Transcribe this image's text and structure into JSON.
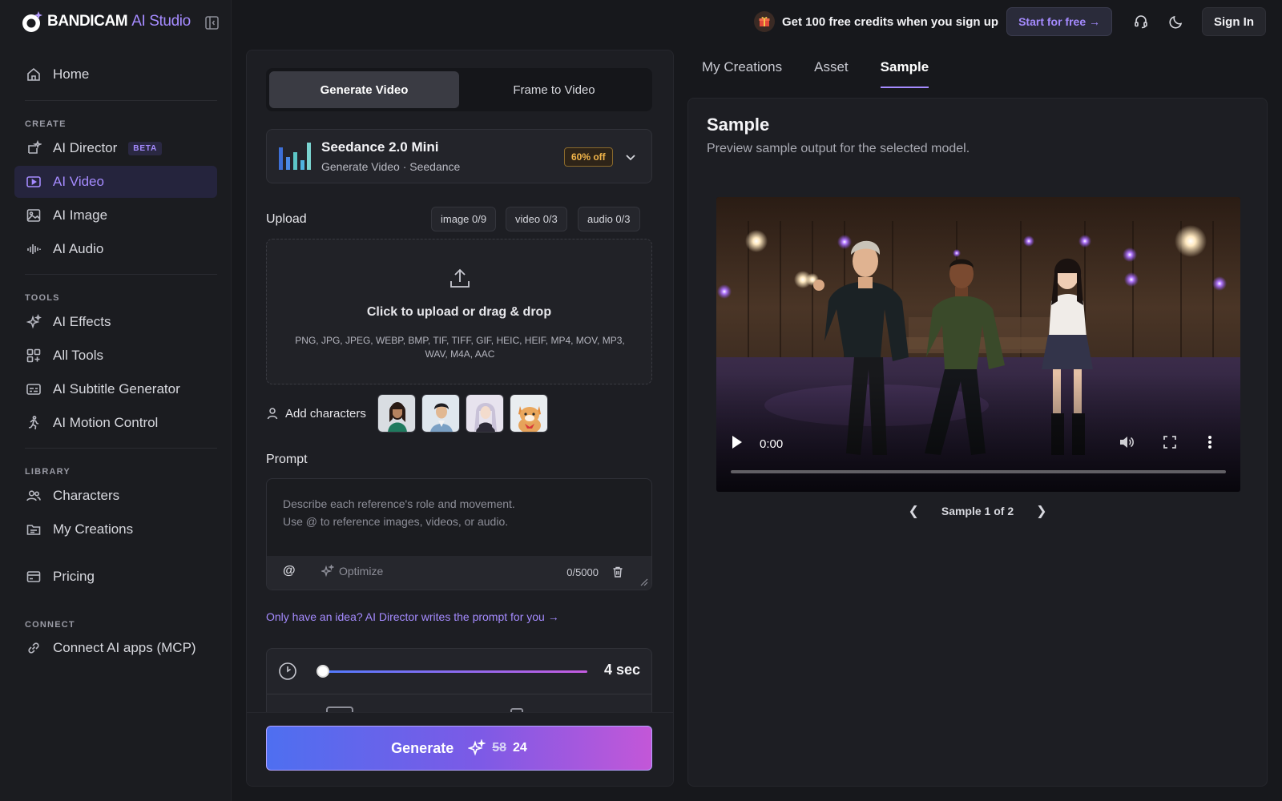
{
  "brand": {
    "name": "BANDICAM",
    "studio": "AI Studio"
  },
  "sidebar": {
    "home": "Home",
    "create_label": "CREATE",
    "create_items": [
      {
        "label": "AI Director",
        "badge": "BETA"
      },
      {
        "label": "AI Video"
      },
      {
        "label": "AI Image"
      },
      {
        "label": "AI Audio"
      }
    ],
    "tools_label": "TOOLS",
    "tools_items": [
      {
        "label": "AI Effects"
      },
      {
        "label": "All Tools"
      },
      {
        "label": "AI Subtitle Generator"
      },
      {
        "label": "AI Motion Control"
      }
    ],
    "library_label": "LIBRARY",
    "library_items": [
      {
        "label": "Characters"
      },
      {
        "label": "My Creations"
      }
    ],
    "pricing": "Pricing",
    "connect_label": "CONNECT",
    "connect_items": [
      {
        "label": "Connect AI apps (MCP)"
      }
    ]
  },
  "topbar": {
    "promo": "Get 100 free credits when you sign up",
    "start_button": "Start for free →",
    "signin": "Sign In"
  },
  "generator": {
    "tabs": [
      "Generate Video",
      "Frame to Video"
    ],
    "active_tab": "Generate Video",
    "model": {
      "name": "Seedance 2.0 Mini",
      "subtitle": "Generate Video · Seedance",
      "discount": "60% off"
    },
    "upload": {
      "label": "Upload",
      "chips": [
        "image 0/9",
        "video 0/3",
        "audio 0/3"
      ],
      "title": "Click to upload or drag & drop",
      "formats": "PNG, JPG, JPEG, WEBP, BMP, TIF, TIFF, GIF, HEIC, HEIF, MP4, MOV, MP3, WAV, M4A, AAC"
    },
    "characters": {
      "label": "Add characters"
    },
    "prompt": {
      "label": "Prompt",
      "placeholder": "Describe each reference's role and movement.\nUse @ to reference images, videos, or audio.",
      "at": "@",
      "optimize": "Optimize",
      "count": "0/5000"
    },
    "idea_link": "Only have an idea? AI Director writes the prompt for you →",
    "duration": {
      "value": "4 sec",
      "fraction": 0.0
    },
    "generate": {
      "label": "Generate",
      "old_cost": "58",
      "new_cost": "24"
    }
  },
  "right": {
    "tabs": [
      "My Creations",
      "Asset",
      "Sample"
    ],
    "active_tab": "Sample",
    "title": "Sample",
    "subtitle": "Preview sample output for the selected model.",
    "video": {
      "time": "0:00",
      "progress": 0.0
    },
    "pager": "Sample 1 of 2"
  },
  "colors": {
    "accent": "#a58bff",
    "background": "#17181c",
    "panel": "#1d1e23",
    "discount": "#f0b44a"
  }
}
